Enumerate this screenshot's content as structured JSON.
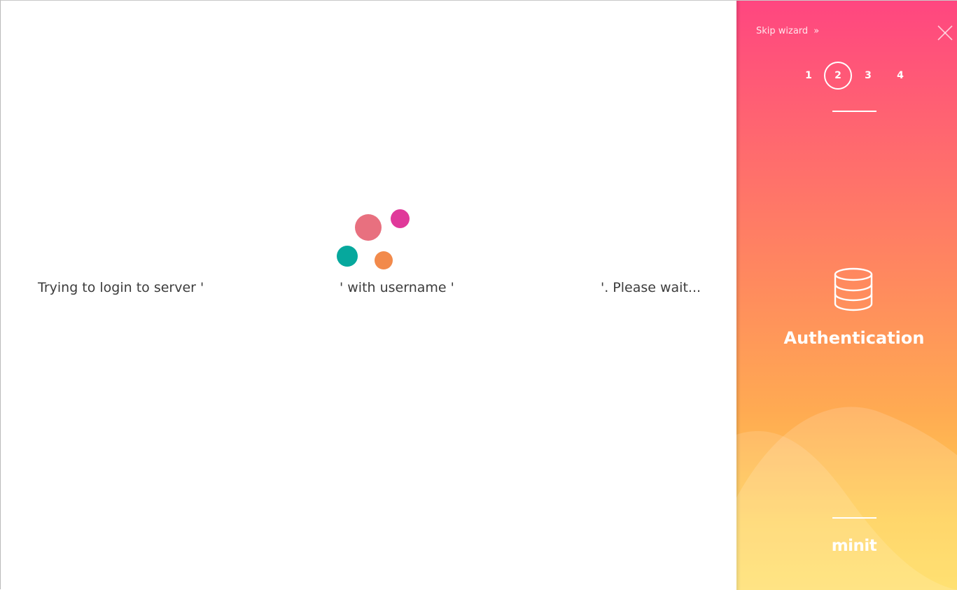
{
  "status": {
    "segments": [
      "Trying to login to server '",
      "' with username '",
      "'. Please wait..."
    ]
  },
  "spinner": {
    "dots": [
      {
        "name": "spinner-dot-rose",
        "color": "#e8707f"
      },
      {
        "name": "spinner-dot-magenta",
        "color": "#e0399a"
      },
      {
        "name": "spinner-dot-teal",
        "color": "#06a89d"
      },
      {
        "name": "spinner-dot-orange",
        "color": "#f28a4b"
      }
    ]
  },
  "wizard": {
    "skip_label": "Skip wizard",
    "skip_icon": "double-chevron-right-icon",
    "close_icon": "close-icon",
    "steps": [
      "1",
      "2",
      "3",
      "4"
    ],
    "active_step": "2",
    "section_icon": "database-icon",
    "section_title": "Authentication",
    "brand": "minit"
  },
  "colors": {
    "panel_top": "#ff4680",
    "panel_bottom": "#ffdc5a",
    "text": "#3c3c3c"
  }
}
